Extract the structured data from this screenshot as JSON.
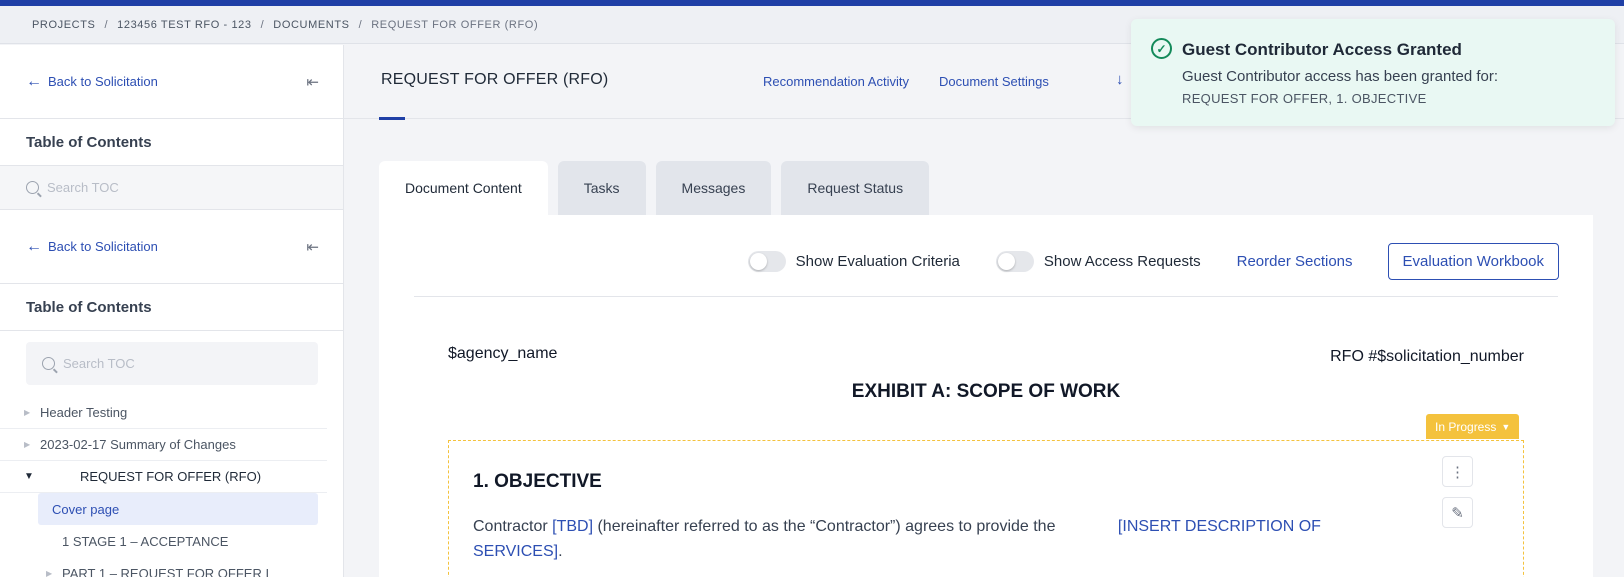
{
  "breadcrumb": {
    "items": [
      "PROJECTS",
      "123456 TEST RFO - 123",
      "DOCUMENTS"
    ],
    "current": "REQUEST FOR OFFER (RFO)",
    "separator": "/"
  },
  "sidebar": {
    "back_label": "Back to Solicitation",
    "toc_title": "Table of Contents",
    "search_placeholder": "Search TOC",
    "items": [
      {
        "label": "Header Testing"
      },
      {
        "label": "2023-02-17 Summary of Changes"
      },
      {
        "label": "REQUEST FOR OFFER (RFO)"
      },
      {
        "label": "Cover page"
      },
      {
        "label": "1 STAGE 1 – ACCEPTANCE"
      },
      {
        "label": "PART 1 – REQUEST FOR OFFER I"
      }
    ]
  },
  "header": {
    "title": "REQUEST FOR OFFER (RFO)",
    "links": {
      "activity": "Recommendation Activity",
      "settings": "Document Settings"
    }
  },
  "tabs": [
    {
      "label": "Document Content",
      "active": true
    },
    {
      "label": "Tasks"
    },
    {
      "label": "Messages"
    },
    {
      "label": "Request Status"
    }
  ],
  "controls": {
    "eval_criteria_label": "Show Evaluation Criteria",
    "access_requests_label": "Show Access Requests",
    "reorder_label": "Reorder Sections",
    "workbook_label": "Evaluation Workbook"
  },
  "document": {
    "agency": "$agency_name",
    "rfo_number": "RFO #$solicitation_number",
    "exhibit_title": "EXHIBIT A: SCOPE OF WORK",
    "status": "In Progress",
    "section_title": "1. OBJECTIVE",
    "body": {
      "part1": "Contractor ",
      "placeholder1": "[TBD]",
      "part2": " (hereinafter referred to as the “Contractor”) agrees to provide the ",
      "placeholder2": "[INSERT DESCRIPTION OF SERVICES]",
      "part3": "."
    }
  },
  "toast": {
    "title": "Guest Contributor Access Granted",
    "message": "Guest Contributor access has been granted for:",
    "detail": "REQUEST FOR OFFER, 1. OBJECTIVE"
  },
  "colors": {
    "brand": "#1f3fa6",
    "link": "#2d4fb3",
    "status": "#f4c23d",
    "success": "#138a5a",
    "toast_bg": "#e9f8f3"
  },
  "icons": [
    "arrow-left-icon",
    "collapse-sidebar-icon",
    "search-icon",
    "download-icon",
    "kebab-menu-icon",
    "edit-icon",
    "check-circle-icon",
    "caret-down-icon"
  ]
}
